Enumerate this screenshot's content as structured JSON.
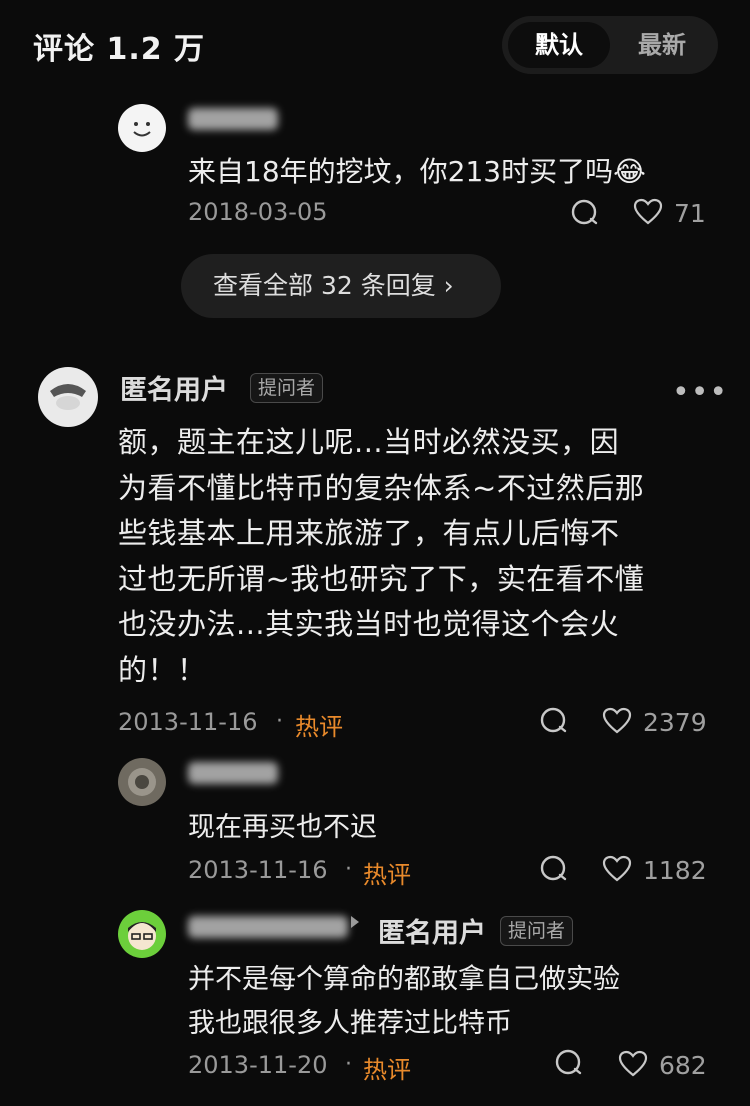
{
  "header": {
    "title": "评论 1.2 万",
    "tabs": [
      "默认",
      "最新"
    ]
  },
  "reply_top": {
    "text": "来自18年的挖坟，你213时买了吗😂",
    "date": "2018-03-05",
    "like_count": "71"
  },
  "view_all_replies": "查看全部 32 条回复 ›",
  "comment": {
    "author": "匿名用户",
    "tag": "提问者",
    "lines": [
      "额，题主在这儿呢...当时必然没买，因",
      "为看不懂比特币的复杂体系~不过然后那",
      "些钱基本上用来旅游了，有点儿后悔不",
      "过也无所谓~我也研究了下，实在看不懂",
      "也没办法...其实我当时也觉得这个会火",
      "的！！"
    ],
    "date": "2013-11-16",
    "separator": "·",
    "hot_label": "热评",
    "like_count": "2379"
  },
  "reply1": {
    "text": "现在再买也不迟",
    "date": "2013-11-16",
    "separator": "·",
    "hot_label": "热评",
    "like_count": "1182"
  },
  "reply2": {
    "reply_to": "匿名用户",
    "tag": "提问者",
    "lines": [
      "并不是每个算命的都敢拿自己做实验",
      "我也跟很多人推荐过比特币"
    ],
    "date": "2013-11-20",
    "separator": "·",
    "hot_label": "热评",
    "like_count": "682"
  },
  "colors": {
    "background": "#0b0b0b",
    "hot": "#e98a2b",
    "secondary_text": "#9a9a9a"
  },
  "icons": [
    "smiley-avatar-icon",
    "comment-icon",
    "heart-icon",
    "more-icon",
    "chevron-right-icon"
  ]
}
